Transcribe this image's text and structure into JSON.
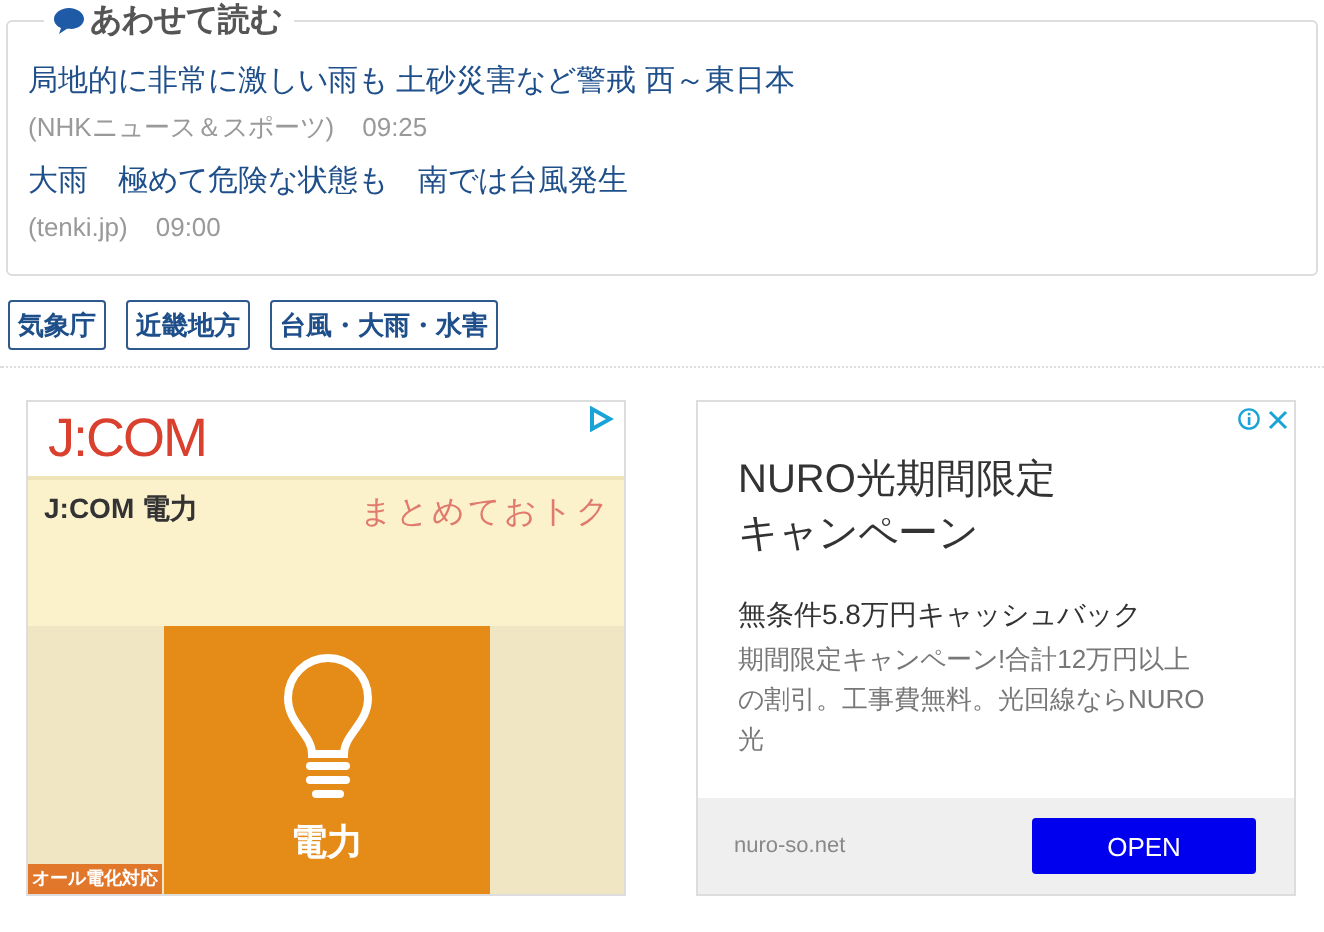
{
  "related": {
    "heading": "あわせて読む",
    "articles": [
      {
        "title": "局地的に非常に激しい雨も 土砂災害など警戒 西～東日本",
        "source": "(NHKニュース＆スポーツ)",
        "time": "09:25"
      },
      {
        "title": "大雨　極めて危険な状態も　南では台風発生",
        "source": "(tenki.jp)",
        "time": "09:00"
      }
    ]
  },
  "tags": [
    "気象庁",
    "近畿地方",
    "台風・大雨・水害"
  ],
  "ad_left": {
    "logo": "J:COM",
    "product": "J:COM 電力",
    "slogan": "まとめておトク",
    "tile_label": "電力",
    "badge": "オール電化対応"
  },
  "ad_right": {
    "title": "NURO光期間限定キャンペーン",
    "headline": "無条件5.8万円キャッシュバック",
    "description": "期間限定キャンペーン!合計12万円以上の割引。工事費無料。光回線ならNURO光",
    "domain": "nuro-so.net",
    "button": "OPEN"
  }
}
